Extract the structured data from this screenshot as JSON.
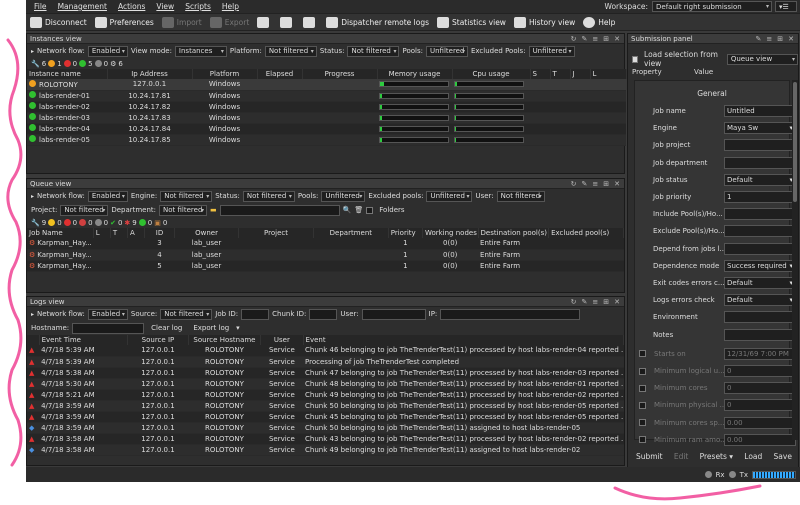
{
  "menu": {
    "items": [
      "File",
      "Management",
      "Actions",
      "View",
      "Scripts",
      "Help"
    ],
    "workspace_label": "Workspace:",
    "workspace_value": "Default right submission"
  },
  "toolbar": {
    "disconnect": "Disconnect",
    "preferences": "Preferences",
    "import": "Import",
    "export": "Export",
    "dispatcher_logs": "Dispatcher remote logs",
    "statistics": "Statistics view",
    "history": "History view",
    "help": "Help"
  },
  "instances": {
    "title": "Instances view",
    "filter": {
      "network_flow_label": "Network flow:",
      "network_flow": "Enabled",
      "view_mode_label": "View mode:",
      "view_mode": "Instances",
      "platform_label": "Platform:",
      "platform": "Not filtered",
      "status_label": "Status:",
      "status": "Not filtered",
      "pools_label": "Pools:",
      "pools": "Unfiltered",
      "excluded_pools_label": "Excluded Pools:",
      "excluded_pools": "Unfiltered"
    },
    "counts": [
      "6",
      "1",
      "0",
      "5",
      "0",
      "6"
    ],
    "columns": [
      "Instance name",
      "Ip Address",
      "Platform",
      "Elapsed",
      "Progress",
      "Memory usage",
      "Cpu usage",
      "S",
      "T",
      "J",
      "L"
    ],
    "rows": [
      {
        "name": "ROLOTONY",
        "ip": "127.0.0.1",
        "platform": "Windows",
        "status": "idle",
        "mem": 0.06,
        "cpu": 0.03
      },
      {
        "name": "labs-render-01",
        "ip": "10.24.17.81",
        "platform": "Windows",
        "status": "on",
        "mem": 0.03,
        "cpu": 0.02
      },
      {
        "name": "labs-render-02",
        "ip": "10.24.17.82",
        "platform": "Windows",
        "status": "on",
        "mem": 0.03,
        "cpu": 0.02
      },
      {
        "name": "labs-render-03",
        "ip": "10.24.17.83",
        "platform": "Windows",
        "status": "on",
        "mem": 0.03,
        "cpu": 0.02
      },
      {
        "name": "labs-render-04",
        "ip": "10.24.17.84",
        "platform": "Windows",
        "status": "on",
        "mem": 0.03,
        "cpu": 0.02
      },
      {
        "name": "labs-render-05",
        "ip": "10.24.17.85",
        "platform": "Windows",
        "status": "on",
        "mem": 0.03,
        "cpu": 0.02
      }
    ]
  },
  "queue": {
    "title": "Queue view",
    "filter": {
      "network_flow_label": "Network flow:",
      "network_flow": "Enabled",
      "engine_label": "Engine:",
      "engine": "Not filtered",
      "status_label": "Status:",
      "status": "Not filtered",
      "pools_label": "Pools:",
      "pools": "Unfiltered",
      "excluded_label": "Excluded pools:",
      "excluded": "Unfiltered",
      "user_label": "User:",
      "user": "Not filtered",
      "project_label": "Project:",
      "project": "Not filtered",
      "department_label": "Department:",
      "department": "Not filtered",
      "folders_label": "Folders"
    },
    "counts": [
      "9",
      "0",
      "0",
      "0",
      "0",
      "0",
      "9",
      "0",
      "0"
    ],
    "columns": [
      "Job Name",
      "L",
      "T",
      "A",
      "ID",
      "Owner",
      "Project",
      "Department",
      "Priority",
      "Working nodes",
      "Destination pool(s)",
      "Excluded pool(s)"
    ],
    "rows": [
      {
        "name": "Karpman_Hay...",
        "id": "3",
        "owner": "lab_user",
        "priority": "1",
        "nodes": "0(0)",
        "dest": "Entire Farm"
      },
      {
        "name": "Karpman_Hay...",
        "id": "4",
        "owner": "lab_user",
        "priority": "1",
        "nodes": "0(0)",
        "dest": "Entire Farm"
      },
      {
        "name": "Karpman_Hay...",
        "id": "5",
        "owner": "lab_user",
        "priority": "1",
        "nodes": "0(0)",
        "dest": "Entire Farm"
      }
    ]
  },
  "logs": {
    "title": "Logs view",
    "filter": {
      "network_flow_label": "Network flow:",
      "network_flow": "Enabled",
      "source_label": "Source:",
      "source": "Not filtered",
      "job_id_label": "Job ID:",
      "chunk_id_label": "Chunk ID:",
      "user_label": "User:",
      "ip_label": "IP:",
      "hostname_label": "Hostname:",
      "clear": "Clear log",
      "export": "Export log"
    },
    "columns": [
      "Event Time",
      "Source IP",
      "Source Hostname",
      "User",
      "Event"
    ],
    "rows": [
      {
        "icon": "warn",
        "time": "4/7/18 5:39 AM",
        "ip": "127.0.0.1",
        "host": "ROLOTONY",
        "user": "Service",
        "event": "Chunk 46 belonging to job TheTrenderTest(11) processed by host labs-render-04 reported ..."
      },
      {
        "icon": "warn",
        "time": "4/7/18 5:39 AM",
        "ip": "127.0.0.1",
        "host": "ROLOTONY",
        "user": "Service",
        "event": "Processing of job TheTrenderTest completed"
      },
      {
        "icon": "warn",
        "time": "4/7/18 5:38 AM",
        "ip": "127.0.0.1",
        "host": "ROLOTONY",
        "user": "Service",
        "event": "Chunk 47 belonging to job TheTrenderTest(11) processed by host labs-render-03 reported ..."
      },
      {
        "icon": "warn",
        "time": "4/7/18 5:30 AM",
        "ip": "127.0.0.1",
        "host": "ROLOTONY",
        "user": "Service",
        "event": "Chunk 48 belonging to job TheTrenderTest(11) processed by host labs-render-01 reported ..."
      },
      {
        "icon": "warn",
        "time": "4/7/18 5:21 AM",
        "ip": "127.0.0.1",
        "host": "ROLOTONY",
        "user": "Service",
        "event": "Chunk 49 belonging to job TheTrenderTest(11) processed by host labs-render-02 reported ..."
      },
      {
        "icon": "warn",
        "time": "4/7/18 3:59 AM",
        "ip": "127.0.0.1",
        "host": "ROLOTONY",
        "user": "Service",
        "event": "Chunk 50 belonging to job TheTrenderTest(11) processed by host labs-render-05 reported ..."
      },
      {
        "icon": "warn",
        "time": "4/7/18 3:59 AM",
        "ip": "127.0.0.1",
        "host": "ROLOTONY",
        "user": "Service",
        "event": "Chunk 45 belonging to job TheTrenderTest(11) processed by host labs-render-05 reported ..."
      },
      {
        "icon": "info",
        "time": "4/7/18 3:59 AM",
        "ip": "127.0.0.1",
        "host": "ROLOTONY",
        "user": "Service",
        "event": "Chunk 50 belonging to job TheTrenderTest(11) assigned to host labs-render-05"
      },
      {
        "icon": "warn",
        "time": "4/7/18 3:58 AM",
        "ip": "127.0.0.1",
        "host": "ROLOTONY",
        "user": "Service",
        "event": "Chunk 43 belonging to job TheTrenderTest(11) processed by host labs-render-02 reported ..."
      },
      {
        "icon": "info",
        "time": "4/7/18 3:58 AM",
        "ip": "127.0.0.1",
        "host": "ROLOTONY",
        "user": "Service",
        "event": "Chunk 49 belonging to job TheTrenderTest(11) assigned to host labs-render-02"
      }
    ]
  },
  "submission": {
    "title": "Submission panel",
    "load_selection_label": "Load selection from view",
    "load_selection_value": "Queue view",
    "col_property": "Property",
    "col_value": "Value",
    "group": "General",
    "fields": [
      {
        "label": "Job name",
        "value": "Untitled",
        "kind": "text"
      },
      {
        "label": "Engine",
        "value": "Maya Sw",
        "kind": "select"
      },
      {
        "label": "Job project",
        "value": "",
        "kind": "text"
      },
      {
        "label": "Job department",
        "value": "",
        "kind": "text"
      },
      {
        "label": "Job status",
        "value": "Default",
        "kind": "select"
      },
      {
        "label": "Job priority",
        "value": "1",
        "kind": "text"
      },
      {
        "label": "Include Pool(s)/Ho...",
        "value": "",
        "kind": "text"
      },
      {
        "label": "Exclude Pool(s)/Ho...",
        "value": "",
        "kind": "text"
      },
      {
        "label": "Depend from jobs l...",
        "value": "",
        "kind": "text"
      },
      {
        "label": "Dependence mode",
        "value": "Success required",
        "kind": "select"
      },
      {
        "label": "Exit codes errors c...",
        "value": "Default",
        "kind": "select"
      },
      {
        "label": "Logs errors check",
        "value": "Default",
        "kind": "select"
      },
      {
        "label": "Environment",
        "value": "",
        "kind": "text"
      },
      {
        "label": "Notes",
        "value": "",
        "kind": "text"
      }
    ],
    "optional": [
      {
        "label": "Starts on",
        "value": "12/31/69 7:00 PM"
      },
      {
        "label": "Minimum logical u...",
        "value": "0"
      },
      {
        "label": "Minimum cores",
        "value": "0"
      },
      {
        "label": "Minimum physical ...",
        "value": "0"
      },
      {
        "label": "Minimum cores sp...",
        "value": "0.00"
      },
      {
        "label": "Minimum ram amo...",
        "value": "0.00"
      }
    ],
    "buttons": {
      "submit": "Submit",
      "edit": "Edit",
      "presets": "Presets",
      "load": "Load",
      "save": "Save"
    }
  },
  "status": {
    "rx": "Rx",
    "tx": "Tx"
  }
}
